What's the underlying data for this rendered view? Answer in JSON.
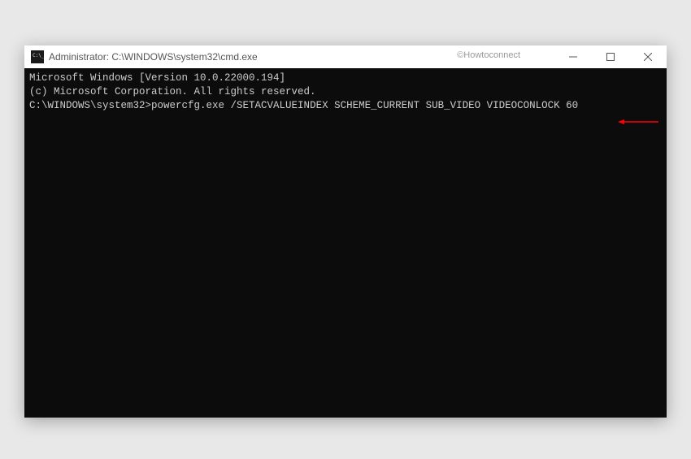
{
  "window": {
    "title": "Administrator: C:\\WINDOWS\\system32\\cmd.exe"
  },
  "watermark": "©Howtoconnect",
  "terminal": {
    "line1": "Microsoft Windows [Version 10.0.22000.194]",
    "line2": "(c) Microsoft Corporation. All rights reserved.",
    "blank": "",
    "prompt": "C:\\WINDOWS\\system32>",
    "command": "powercfg.exe /SETACVALUEINDEX SCHEME_CURRENT SUB_VIDEO VIDEOCONLOCK 60"
  }
}
